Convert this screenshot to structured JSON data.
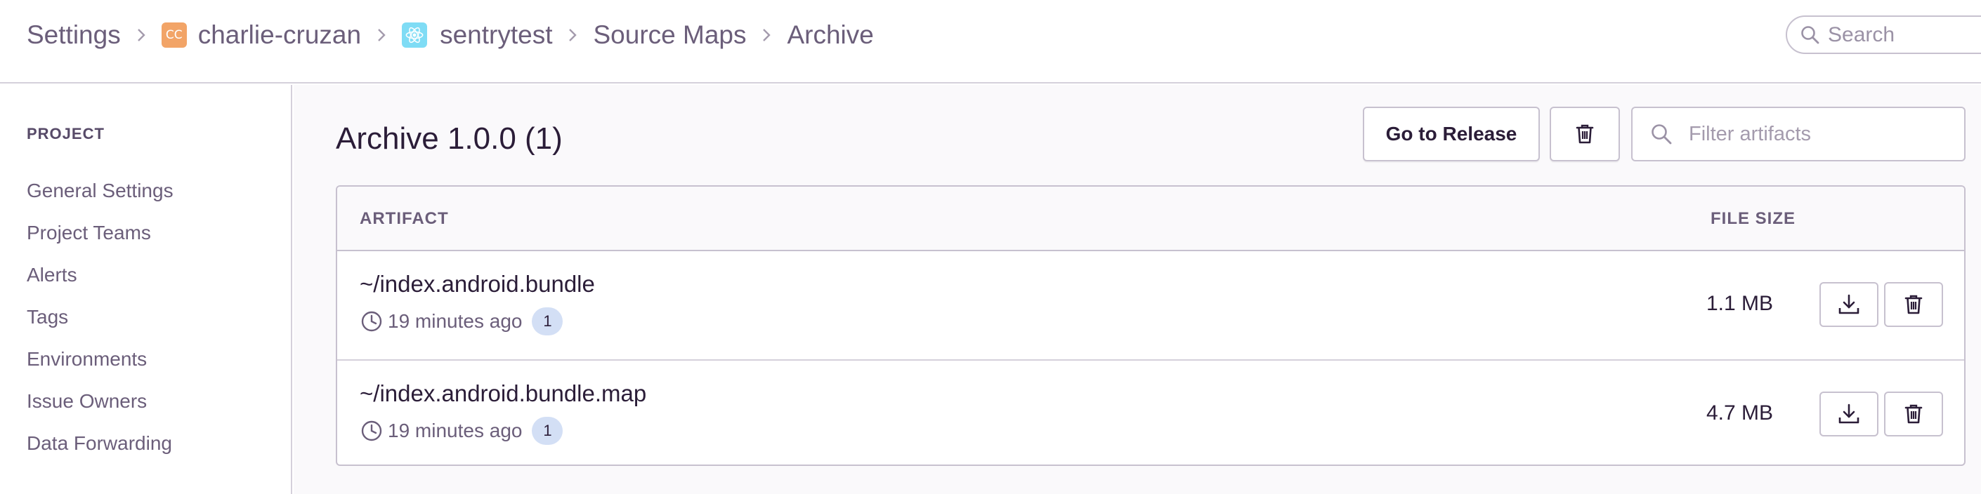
{
  "header": {
    "breadcrumbs": {
      "settings": "Settings",
      "org_badge": "CC",
      "org": "charlie-cruzan",
      "project": "sentrytest",
      "source_maps": "Source Maps",
      "archive": "Archive"
    },
    "search_placeholder": "Search"
  },
  "sidebar": {
    "heading": "PROJECT",
    "items": [
      {
        "label": "General Settings"
      },
      {
        "label": "Project Teams"
      },
      {
        "label": "Alerts"
      },
      {
        "label": "Tags"
      },
      {
        "label": "Environments"
      },
      {
        "label": "Issue Owners"
      },
      {
        "label": "Data Forwarding"
      }
    ]
  },
  "main": {
    "title": "Archive 1.0.0 (1)",
    "go_to_release_label": "Go to Release",
    "filter_placeholder": "Filter artifacts",
    "table": {
      "columns": {
        "artifact": "ARTIFACT",
        "file_size": "FILE SIZE"
      },
      "rows": [
        {
          "name": "~/index.android.bundle",
          "time": "19 minutes ago",
          "count": "1",
          "size": "1.1 MB"
        },
        {
          "name": "~/index.android.bundle.map",
          "time": "19 minutes ago",
          "count": "1",
          "size": "4.7 MB"
        }
      ]
    }
  },
  "icons": {
    "breadcrumb_separator": "chevron-right-icon",
    "search": "search-icon",
    "delete": "trash-icon",
    "download": "download-icon",
    "time": "clock-icon",
    "project_platform": "react-icon"
  },
  "colors": {
    "org_badge": "#f2a467",
    "project_badge": "#7fdcf5",
    "count_badge": "#d3dff5",
    "text_primary": "#2b1d38",
    "text_secondary": "#6b5e7a",
    "border": "#c7c1cf"
  }
}
